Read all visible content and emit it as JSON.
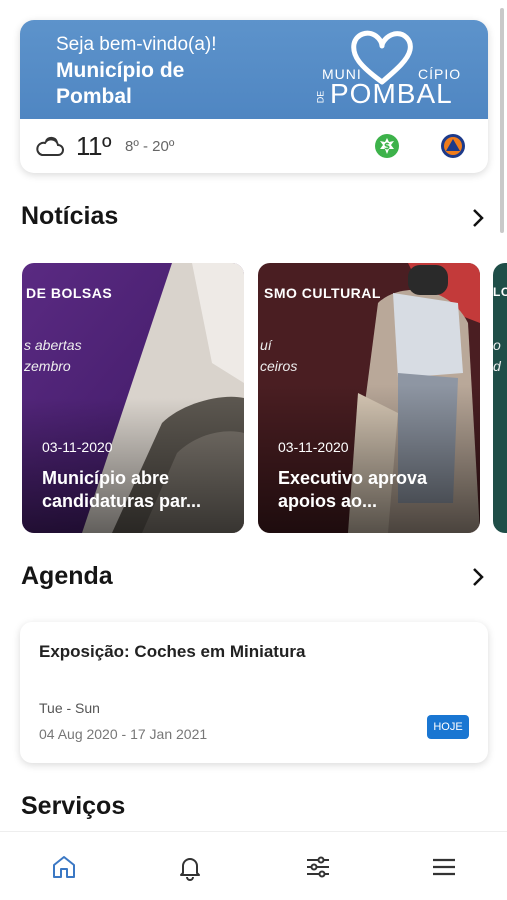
{
  "header": {
    "welcome": "Seja bem-vindo(a)!",
    "municipality": "Município de Pombal",
    "logo": {
      "muni": "MUNI",
      "cipio": "CÍPIO",
      "de": "DE",
      "pombal": "POMBAL"
    }
  },
  "weather": {
    "icon": "cloudy-icon",
    "temperature": "11º",
    "range": "8º - 20º"
  },
  "news": {
    "title": "Notícias",
    "items": [
      {
        "tag": "DE BOLSAS",
        "sub_line1": "s abertas",
        "sub_line2": "zembro",
        "date": "03-11-2020",
        "title": "Município abre candidaturas par..."
      },
      {
        "tag": "SMO CULTURAL",
        "sub_line1": "uí",
        "sub_line2": "ceiros",
        "date": "03-11-2020",
        "title": "Executivo aprova apoios ao..."
      },
      {
        "tag": "LO",
        "sub_line1": "o",
        "sub_line2": "d",
        "date": "",
        "title": ""
      }
    ]
  },
  "agenda": {
    "title": "Agenda",
    "event": {
      "title": "Exposição: Coches em Miniatura",
      "days": "Tue - Sun",
      "dates": "04 Aug 2020 - 17 Jan 2021",
      "badge": "HOJE"
    }
  },
  "services": {
    "title": "Serviços"
  },
  "colors": {
    "brand_blue": "#5d93cb",
    "badge_blue": "#1976d2",
    "nav_active": "#3b78c4"
  },
  "nav": [
    "home-icon",
    "bell-icon",
    "sliders-icon",
    "menu-icon"
  ]
}
